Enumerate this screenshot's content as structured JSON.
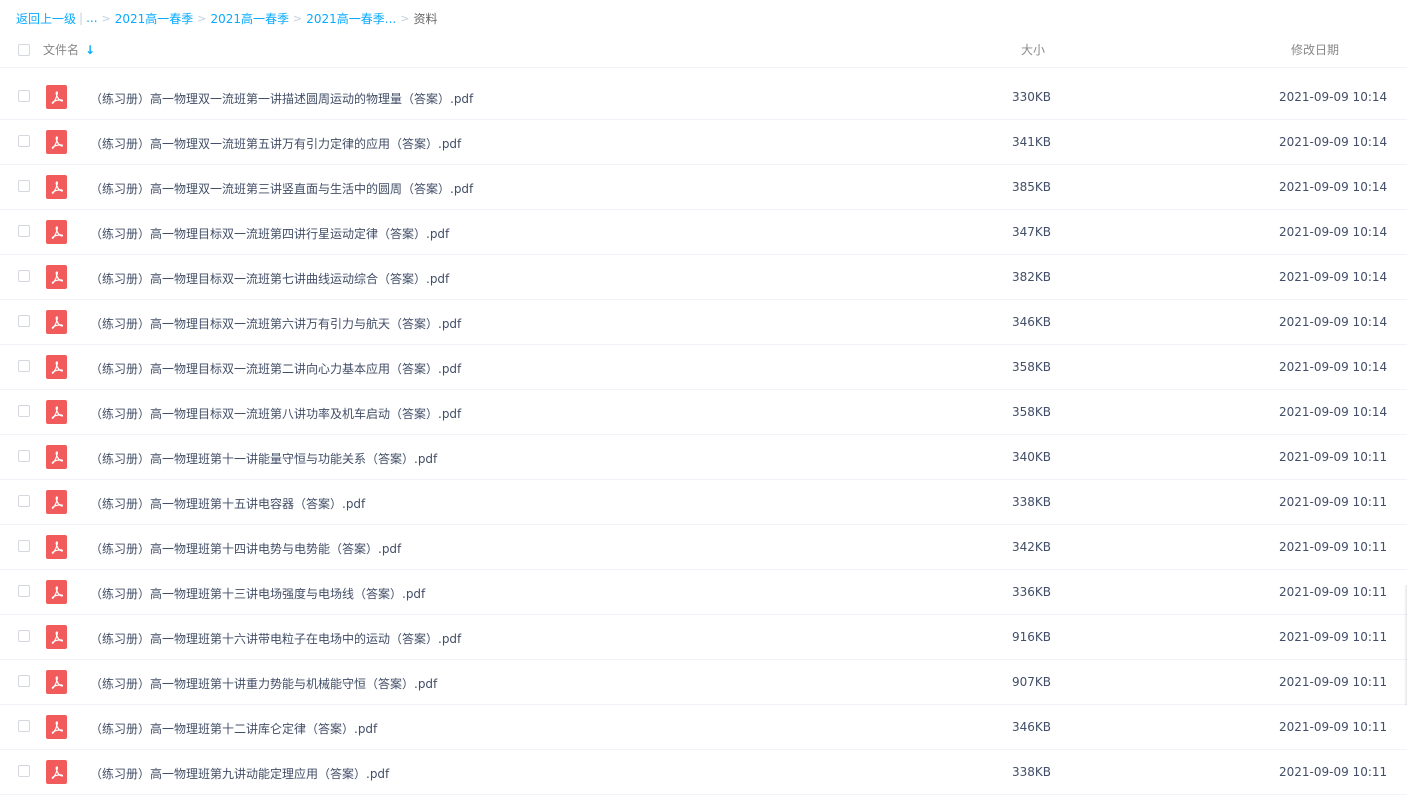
{
  "breadcrumb": {
    "back": "返回上一级",
    "ellipsis": "...",
    "items": [
      "2021高一春季",
      "2021高一春季",
      "2021高一春季..."
    ],
    "current": "资料"
  },
  "header": {
    "name": "文件名",
    "size": "大小",
    "date": "修改日期"
  },
  "files": [
    {
      "name": "（练习册）高一物理双一流班第一讲描述圆周运动的物理量（答案）.pdf",
      "size": "330KB",
      "date": "2021-09-09 10:14"
    },
    {
      "name": "（练习册）高一物理双一流班第五讲万有引力定律的应用（答案）.pdf",
      "size": "341KB",
      "date": "2021-09-09 10:14"
    },
    {
      "name": "（练习册）高一物理双一流班第三讲竖直面与生活中的圆周（答案）.pdf",
      "size": "385KB",
      "date": "2021-09-09 10:14"
    },
    {
      "name": "（练习册）高一物理目标双一流班第四讲行星运动定律（答案）.pdf",
      "size": "347KB",
      "date": "2021-09-09 10:14"
    },
    {
      "name": "（练习册）高一物理目标双一流班第七讲曲线运动综合（答案）.pdf",
      "size": "382KB",
      "date": "2021-09-09 10:14"
    },
    {
      "name": "（练习册）高一物理目标双一流班第六讲万有引力与航天（答案）.pdf",
      "size": "346KB",
      "date": "2021-09-09 10:14"
    },
    {
      "name": "（练习册）高一物理目标双一流班第二讲向心力基本应用（答案）.pdf",
      "size": "358KB",
      "date": "2021-09-09 10:14"
    },
    {
      "name": "（练习册）高一物理目标双一流班第八讲功率及机车启动（答案）.pdf",
      "size": "358KB",
      "date": "2021-09-09 10:14"
    },
    {
      "name": "（练习册）高一物理班第十一讲能量守恒与功能关系（答案）.pdf",
      "size": "340KB",
      "date": "2021-09-09 10:11"
    },
    {
      "name": "（练习册）高一物理班第十五讲电容器（答案）.pdf",
      "size": "338KB",
      "date": "2021-09-09 10:11"
    },
    {
      "name": "（练习册）高一物理班第十四讲电势与电势能（答案）.pdf",
      "size": "342KB",
      "date": "2021-09-09 10:11"
    },
    {
      "name": "（练习册）高一物理班第十三讲电场强度与电场线（答案）.pdf",
      "size": "336KB",
      "date": "2021-09-09 10:11"
    },
    {
      "name": "（练习册）高一物理班第十六讲带电粒子在电场中的运动（答案）.pdf",
      "size": "916KB",
      "date": "2021-09-09 10:11"
    },
    {
      "name": "（练习册）高一物理班第十讲重力势能与机械能守恒（答案）.pdf",
      "size": "907KB",
      "date": "2021-09-09 10:11"
    },
    {
      "name": "（练习册）高一物理班第十二讲库仑定律（答案）.pdf",
      "size": "346KB",
      "date": "2021-09-09 10:11"
    },
    {
      "name": "（练习册）高一物理班第九讲动能定理应用（答案）.pdf",
      "size": "338KB",
      "date": "2021-09-09 10:11"
    }
  ],
  "icons": {
    "file": "pdf-file-icon",
    "sort": "sort-down-arrow-icon"
  },
  "colors": {
    "link": "#09aaff",
    "pdf_icon": "#f25b5b",
    "text": "#424e67"
  }
}
